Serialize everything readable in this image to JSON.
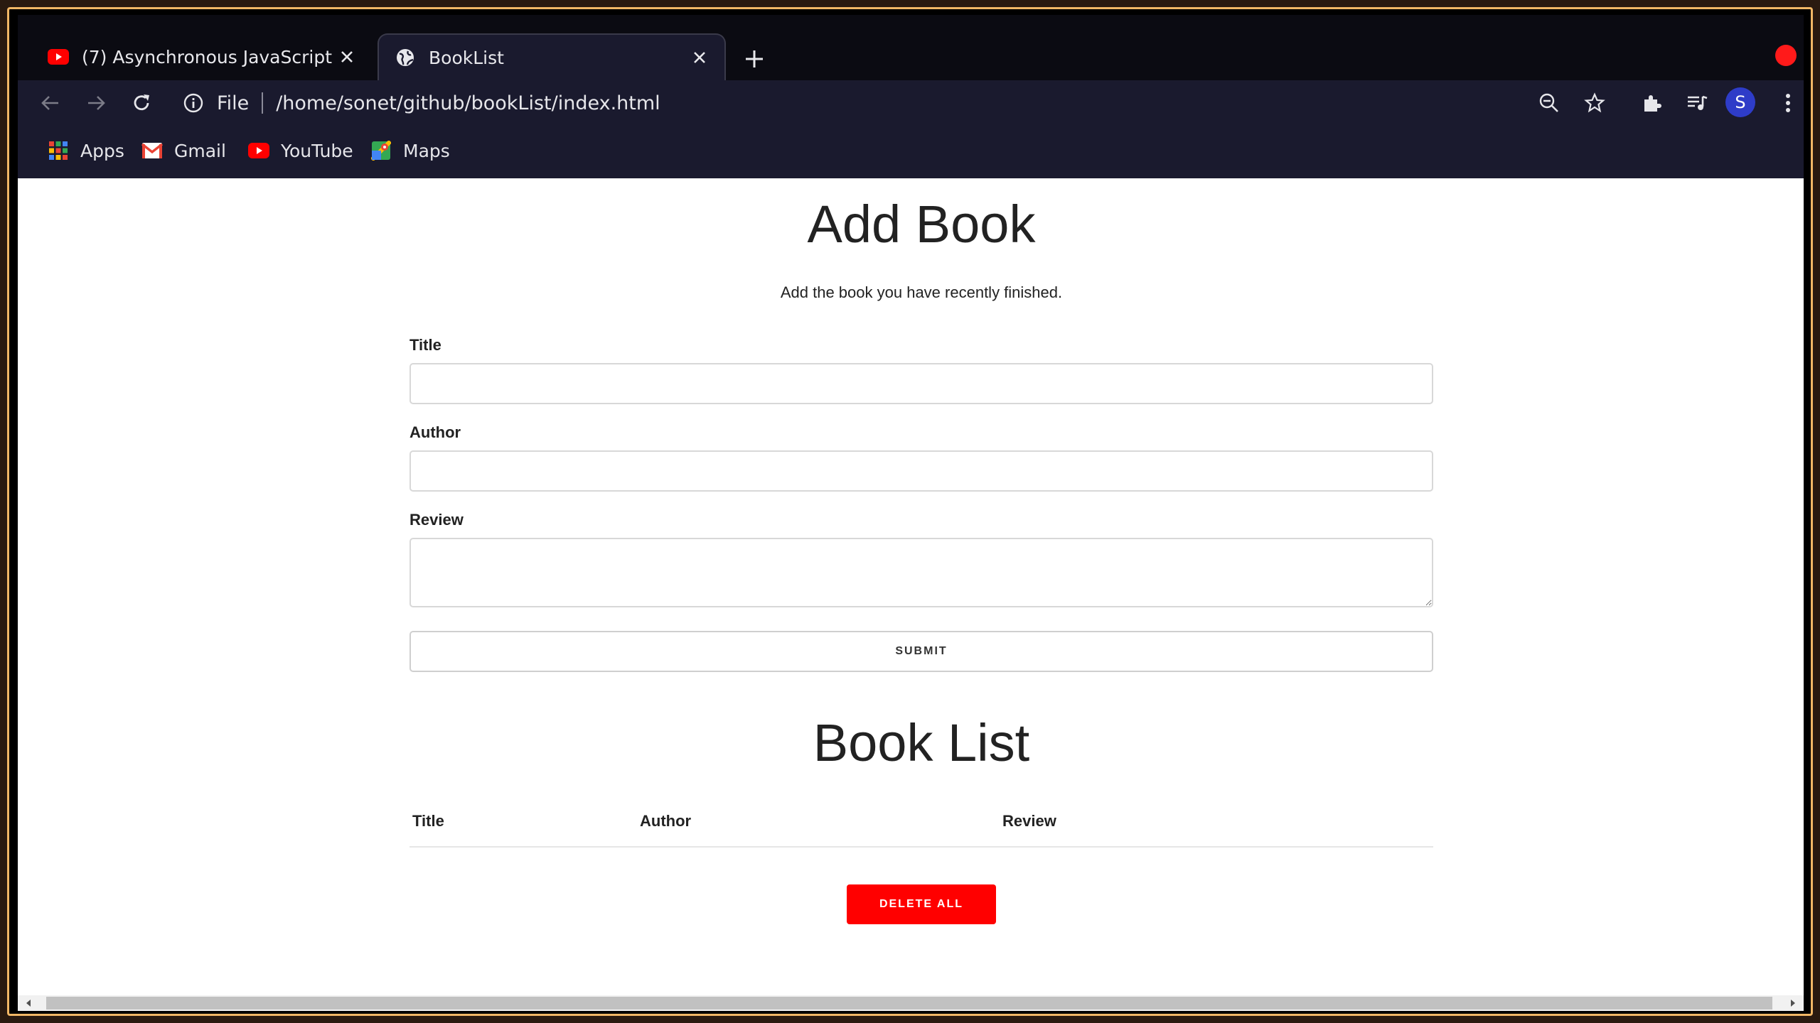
{
  "tabs": [
    {
      "title": "(7) Asynchronous JavaScript -",
      "icon": "youtube-icon",
      "active": false
    },
    {
      "title": "BookList",
      "icon": "globe-icon",
      "active": true
    }
  ],
  "toolbar": {
    "scheme": "File",
    "url": "/home/sonet/github/bookList/index.html",
    "avatar_letter": "S"
  },
  "bookmarks": [
    {
      "label": "Apps",
      "icon": "apps-grid-icon"
    },
    {
      "label": "Gmail",
      "icon": "gmail-icon"
    },
    {
      "label": "YouTube",
      "icon": "youtube-icon"
    },
    {
      "label": "Maps",
      "icon": "maps-icon"
    }
  ],
  "page": {
    "add_title": "Add Book",
    "subtitle": "Add the book you have recently finished.",
    "form": {
      "title_label": "Title",
      "title_value": "",
      "author_label": "Author",
      "author_value": "",
      "review_label": "Review",
      "review_value": "",
      "submit_label": "SUBMIT"
    },
    "list_title": "Book List",
    "table_headers": [
      "Title",
      "Author",
      "Review"
    ],
    "delete_all_label": "DELETE ALL"
  },
  "colors": {
    "accent_red": "#ff0000",
    "chrome_dark": "#1a1a2e",
    "frame_orange": "#f2b766"
  }
}
